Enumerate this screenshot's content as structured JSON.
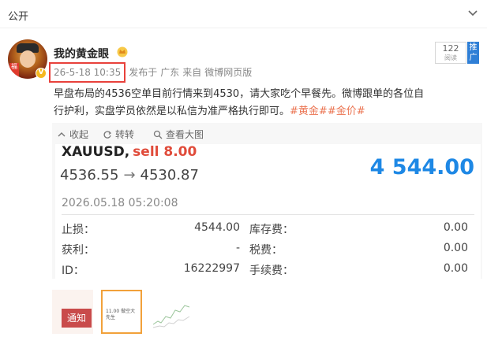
{
  "header": {
    "title": "公开"
  },
  "post": {
    "username": "我的黄金眼",
    "time": "26-5-18 10:35",
    "published_label": "发布于",
    "location": "广东",
    "source_label": "来自",
    "source": "微博网页版",
    "follow": {
      "count": "122",
      "count_label": "阅读",
      "button": "推广"
    },
    "text_line1": "早盘布局的4536空单目前行情来到4530，请大家吃个早餐先。微博跟单的各位自",
    "text_line2": "行护利，实盘学员依然是以私信为准严格执行即可。",
    "tags": [
      "#黄金#",
      "#金价#"
    ]
  },
  "repost_actions": {
    "collect": "收起",
    "forward": "转转",
    "view_large": "查看大图"
  },
  "trade": {
    "symbol": "XAUUSD,",
    "side": "sell 8.00",
    "open_price": "4536.55",
    "arrow": "→",
    "close_price": "4530.87",
    "current": "4 544.00",
    "datetime": "2026.05.18 05:20:08",
    "rows": [
      {
        "label1": "止损：",
        "value1": "4544.00",
        "label2": "库存费：",
        "value2": "0.00"
      },
      {
        "label1": "获利：",
        "value1": "-",
        "label2": "税费：",
        "value2": "0.00"
      },
      {
        "label1": "ID：",
        "value1": "16222997",
        "label2": "手续费：",
        "value2": "0.00"
      }
    ]
  },
  "thumbnails": {
    "notice": "通知",
    "mini_text": "11.00 做空大 先生"
  },
  "colors": {
    "accent_blue": "#1e88e5",
    "sell_red": "#e04b3a",
    "tag_orange": "#eb7350",
    "highlight_box": "#e8413b"
  }
}
